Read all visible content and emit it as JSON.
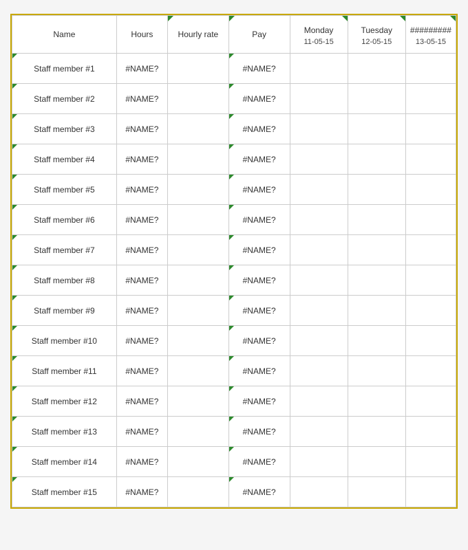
{
  "table": {
    "headers": [
      {
        "id": "name",
        "label": "Name",
        "sub": ""
      },
      {
        "id": "hours",
        "label": "Hours",
        "sub": ""
      },
      {
        "id": "hourly",
        "label": "Hourly rate",
        "sub": ""
      },
      {
        "id": "pay",
        "label": "Pay",
        "sub": ""
      },
      {
        "id": "monday",
        "label": "Monday",
        "sub": "11-05-15"
      },
      {
        "id": "tuesday",
        "label": "Tuesday",
        "sub": "12-05-15"
      },
      {
        "id": "wednesday",
        "label": "#########",
        "sub": "13-05-15"
      }
    ],
    "rows": [
      {
        "name": "Staff member #1",
        "hours": "#NAME?",
        "hourly": "",
        "pay": "#NAME?"
      },
      {
        "name": "Staff member #2",
        "hours": "#NAME?",
        "hourly": "",
        "pay": "#NAME?"
      },
      {
        "name": "Staff member #3",
        "hours": "#NAME?",
        "hourly": "",
        "pay": "#NAME?"
      },
      {
        "name": "Staff member #4",
        "hours": "#NAME?",
        "hourly": "",
        "pay": "#NAME?"
      },
      {
        "name": "Staff member #5",
        "hours": "#NAME?",
        "hourly": "",
        "pay": "#NAME?"
      },
      {
        "name": "Staff member #6",
        "hours": "#NAME?",
        "hourly": "",
        "pay": "#NAME?"
      },
      {
        "name": "Staff member #7",
        "hours": "#NAME?",
        "hourly": "",
        "pay": "#NAME?"
      },
      {
        "name": "Staff member #8",
        "hours": "#NAME?",
        "hourly": "",
        "pay": "#NAME?"
      },
      {
        "name": "Staff member #9",
        "hours": "#NAME?",
        "hourly": "",
        "pay": "#NAME?"
      },
      {
        "name": "Staff member #10",
        "hours": "#NAME?",
        "hourly": "",
        "pay": "#NAME?"
      },
      {
        "name": "Staff member #11",
        "hours": "#NAME?",
        "hourly": "",
        "pay": "#NAME?"
      },
      {
        "name": "Staff member #12",
        "hours": "#NAME?",
        "hourly": "",
        "pay": "#NAME?"
      },
      {
        "name": "Staff member #13",
        "hours": "#NAME?",
        "hourly": "",
        "pay": "#NAME?"
      },
      {
        "name": "Staff member #14",
        "hours": "#NAME?",
        "hourly": "",
        "pay": "#NAME?"
      },
      {
        "name": "Staff member #15",
        "hours": "#NAME?",
        "hourly": "",
        "pay": "#NAME?"
      }
    ]
  }
}
